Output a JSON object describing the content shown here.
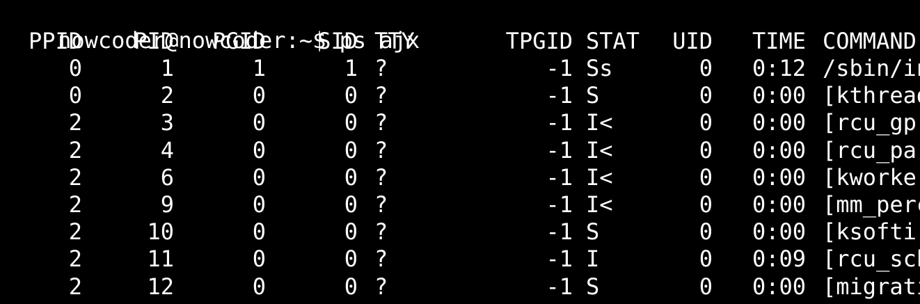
{
  "terminal": {
    "background": "#000000",
    "foreground": "#ffffff",
    "prompt": "nowcoder@nowcoder:~$ ps ajx"
  },
  "table": {
    "headers": [
      "PPID",
      "PID",
      "PGID",
      "SID",
      "TTY",
      "TPGID",
      "STAT",
      "UID",
      "TIME",
      "COMMAND"
    ],
    "rows": [
      [
        "0",
        "1",
        "1",
        "1",
        "?",
        "-1",
        "Ss",
        "0",
        "0:12",
        "/sbin/in"
      ],
      [
        "0",
        "2",
        "0",
        "0",
        "?",
        "-1",
        "S",
        "0",
        "0:00",
        "[kthread"
      ],
      [
        "2",
        "3",
        "0",
        "0",
        "?",
        "-1",
        "I<",
        "0",
        "0:00",
        "[rcu_gp]"
      ],
      [
        "2",
        "4",
        "0",
        "0",
        "?",
        "-1",
        "I<",
        "0",
        "0:00",
        "[rcu_par"
      ],
      [
        "2",
        "6",
        "0",
        "0",
        "?",
        "-1",
        "I<",
        "0",
        "0:00",
        "[kworker"
      ],
      [
        "2",
        "9",
        "0",
        "0",
        "?",
        "-1",
        "I<",
        "0",
        "0:00",
        "[mm_perc"
      ],
      [
        "2",
        "10",
        "0",
        "0",
        "?",
        "-1",
        "S",
        "0",
        "0:00",
        "[ksoftir"
      ],
      [
        "2",
        "11",
        "0",
        "0",
        "?",
        "-1",
        "I",
        "0",
        "0:09",
        "[rcu_sch"
      ],
      [
        "2",
        "12",
        "0",
        "0",
        "?",
        "-1",
        "S",
        "0",
        "0:00",
        "[migrati"
      ]
    ]
  }
}
